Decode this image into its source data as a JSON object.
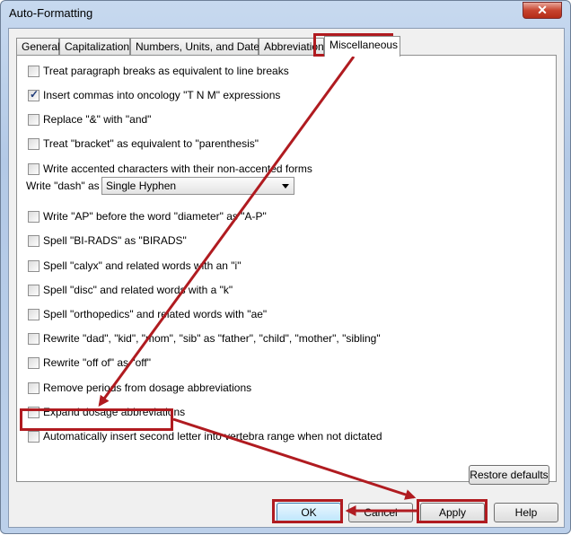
{
  "window": {
    "title": "Auto-Formatting",
    "close_glyph": "✕"
  },
  "tabs": [
    {
      "label": "General"
    },
    {
      "label": "Capitalization"
    },
    {
      "label": "Numbers, Units, and Dates"
    },
    {
      "label": "Abbreviations"
    },
    {
      "label": "Miscellaneous",
      "active": true
    }
  ],
  "options": [
    {
      "label": "Treat paragraph breaks as equivalent to line breaks",
      "checked": false
    },
    {
      "label": "Insert commas into oncology \"T N M\" expressions",
      "checked": true
    },
    {
      "label": "Replace \"&\" with \"and\"",
      "checked": false
    },
    {
      "label": "Treat \"bracket\" as equivalent to \"parenthesis\"",
      "checked": false
    },
    {
      "label": "Write accented characters with their non-accented forms",
      "checked": false
    }
  ],
  "dash": {
    "label": "Write \"dash\" as",
    "selected": "Single Hyphen"
  },
  "options2": [
    {
      "label": "Write \"AP\" before the word \"diameter\" as \"A-P\"",
      "checked": false
    },
    {
      "label": "Spell \"BI-RADS\" as \"BIRADS\"",
      "checked": false
    },
    {
      "label": "Spell \"calyx\" and related words with an \"i\"",
      "checked": false
    },
    {
      "label": "Spell \"disc\" and related words with a \"k\"",
      "checked": false
    },
    {
      "label": "Spell \"orthopedics\" and related words with \"ae\"",
      "checked": false
    },
    {
      "label": "Rewrite \"dad\", \"kid\", \"mom\", \"sib\" as \"father\", \"child\", \"mother\", \"sibling\"",
      "checked": false
    },
    {
      "label": "Rewrite \"off of\" as \"off\"",
      "checked": false
    },
    {
      "label": "Remove periods from dosage abbreviations",
      "checked": false
    },
    {
      "label": "Expand dosage abbreviations",
      "checked": false
    },
    {
      "label": "Automatically insert second letter into vertebra range when not dictated",
      "checked": false
    }
  ],
  "buttons": {
    "restore": "Restore defaults",
    "ok": "OK",
    "cancel": "Cancel",
    "apply": "Apply",
    "help": "Help"
  },
  "annotation_color": "#b01b20"
}
